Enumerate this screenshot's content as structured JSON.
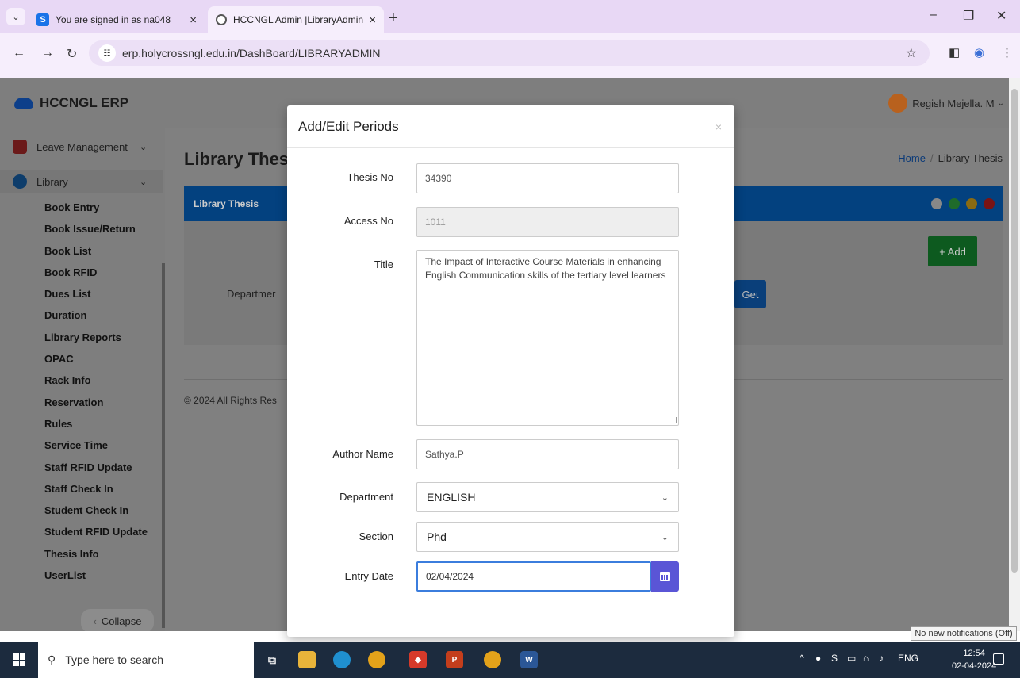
{
  "browser": {
    "tabs": [
      {
        "title": "You are signed in as na048",
        "close": "×"
      },
      {
        "title": "HCCNGL Admin |LibraryAdmin",
        "close": "×"
      }
    ],
    "new_tab": "+",
    "url": "erp.holycrossngl.edu.in/DashBoard/LIBRARYADMIN"
  },
  "app": {
    "brand": "HCCNGL ERP",
    "user": "Regish Mejella. M"
  },
  "sidebar": {
    "leave_management": "Leave Management",
    "library": "Library",
    "items": [
      "Book Entry",
      "Book Issue/Return",
      "Book List",
      "Book RFID",
      "Dues List",
      "Duration",
      "Library Reports",
      "OPAC",
      "Rack Info",
      "Reservation",
      "Rules",
      "Service Time",
      "Staff RFID Update",
      "Staff Check In",
      "Student Check In",
      "Student RFID Update",
      "Thesis Info",
      "UserList"
    ],
    "collapse": "Collapse"
  },
  "main": {
    "heading": "Library Thesi",
    "breadcrumb": {
      "home": "Home",
      "current": "Library Thesis"
    },
    "panel_title": "Library Thesis",
    "add_button": "+ Add",
    "department_label": "Departmer",
    "get_button": "Get",
    "copyright": "© 2024 All Rights Res"
  },
  "modal": {
    "title": "Add/Edit Periods",
    "close": "×",
    "fields": {
      "thesis_no": {
        "label": "Thesis No",
        "value": "34390"
      },
      "access_no": {
        "label": "Access No",
        "value": "1011"
      },
      "title": {
        "label": "Title",
        "value": "The Impact of Interactive Course Materials in enhancing English Communication skills of the tertiary level learners"
      },
      "author": {
        "label": "Author Name",
        "value": "Sathya.P"
      },
      "department": {
        "label": "Department",
        "value": "ENGLISH"
      },
      "section": {
        "label": "Section",
        "value": "Phd"
      },
      "entry_date": {
        "label": "Entry Date",
        "value": "02/04/2024"
      }
    }
  },
  "notification_tooltip": "No new notifications (Off)",
  "taskbar": {
    "search_placeholder": "Type here to search",
    "language": "ENG",
    "time": "12:54",
    "date": "02-04-2024"
  }
}
